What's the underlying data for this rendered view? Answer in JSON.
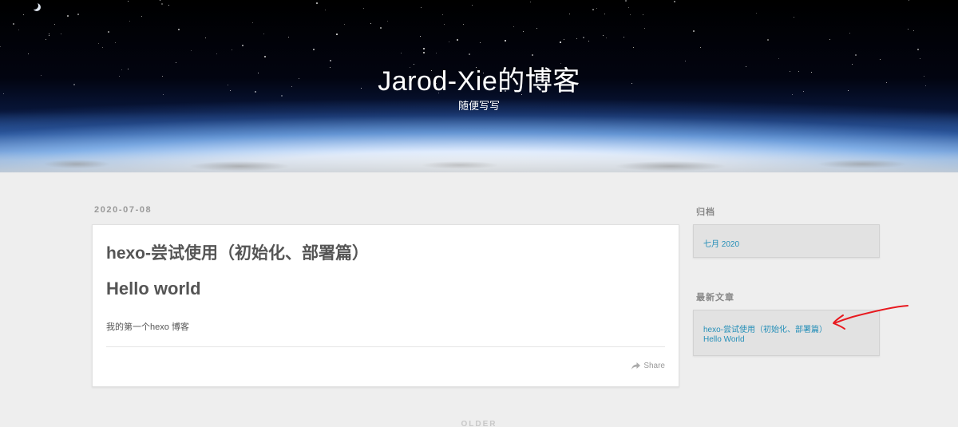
{
  "site": {
    "title": "Jarod-Xie的博客",
    "subtitle": "随便写写"
  },
  "post": {
    "date": "2020-07-08",
    "title": "hexo-尝试使用（初始化、部署篇）",
    "heading": "Hello world",
    "body": "我的第一个hexo 博客",
    "share_label": "Share",
    "share_icon": "share-icon"
  },
  "sidebar": {
    "archive": {
      "title": "归档",
      "items": [
        "七月 2020"
      ]
    },
    "recent": {
      "title": "最新文章",
      "items": [
        "hexo-尝试使用（初始化、部署篇）",
        "Hello World"
      ]
    }
  },
  "pager": {
    "older_label": "OLDER"
  },
  "colors": {
    "link": "#258fb8",
    "background": "#eeeeee",
    "annotation": "#e8191f"
  }
}
